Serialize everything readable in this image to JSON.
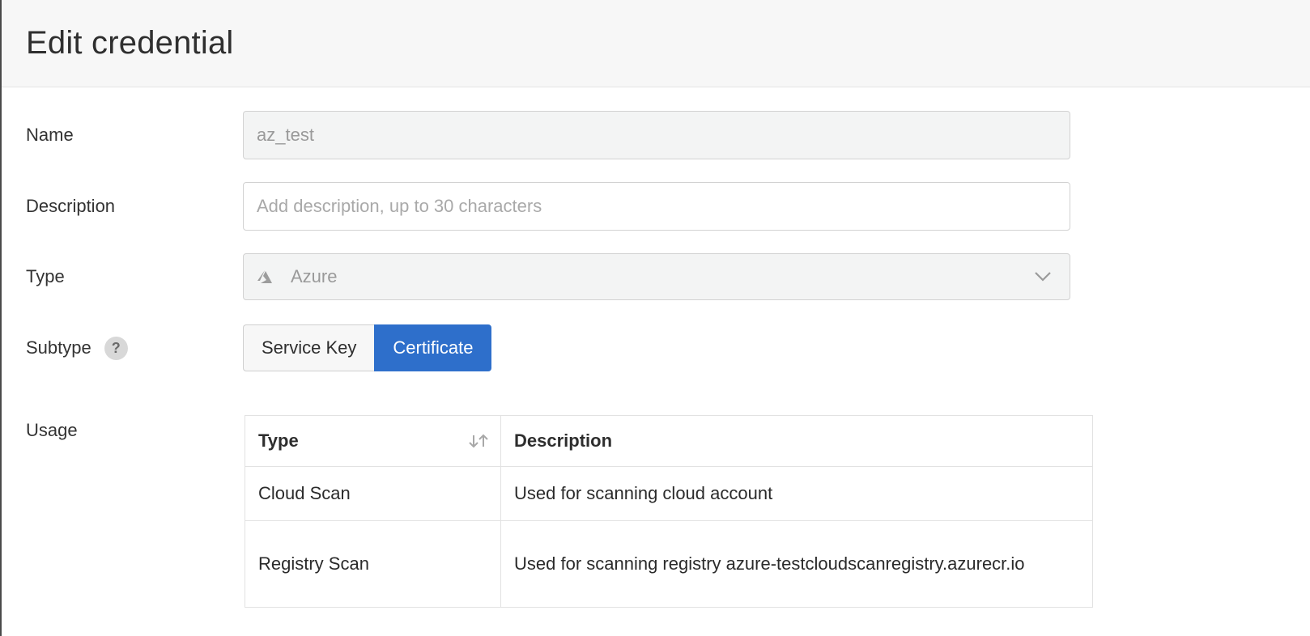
{
  "header": {
    "title": "Edit credential"
  },
  "form": {
    "name": {
      "label": "Name",
      "value": "az_test"
    },
    "description": {
      "label": "Description",
      "placeholder": "Add description, up to 30 characters",
      "value": ""
    },
    "type": {
      "label": "Type",
      "value": "Azure",
      "icon": "azure-icon"
    },
    "subtype": {
      "label": "Subtype",
      "help_glyph": "?",
      "options": [
        "Service Key",
        "Certificate"
      ],
      "selected": "Certificate"
    },
    "usage": {
      "label": "Usage",
      "columns": [
        "Type",
        "Description"
      ],
      "rows": [
        {
          "type": "Cloud Scan",
          "description": "Used for scanning cloud account"
        },
        {
          "type": "Registry Scan",
          "description": "Used for scanning registry azure-testcloudscanregistry.azurecr.io"
        }
      ]
    }
  },
  "colors": {
    "accent": "#2e6fcb",
    "disabled_bg": "#f3f4f4",
    "header_bg": "#f7f7f7"
  }
}
